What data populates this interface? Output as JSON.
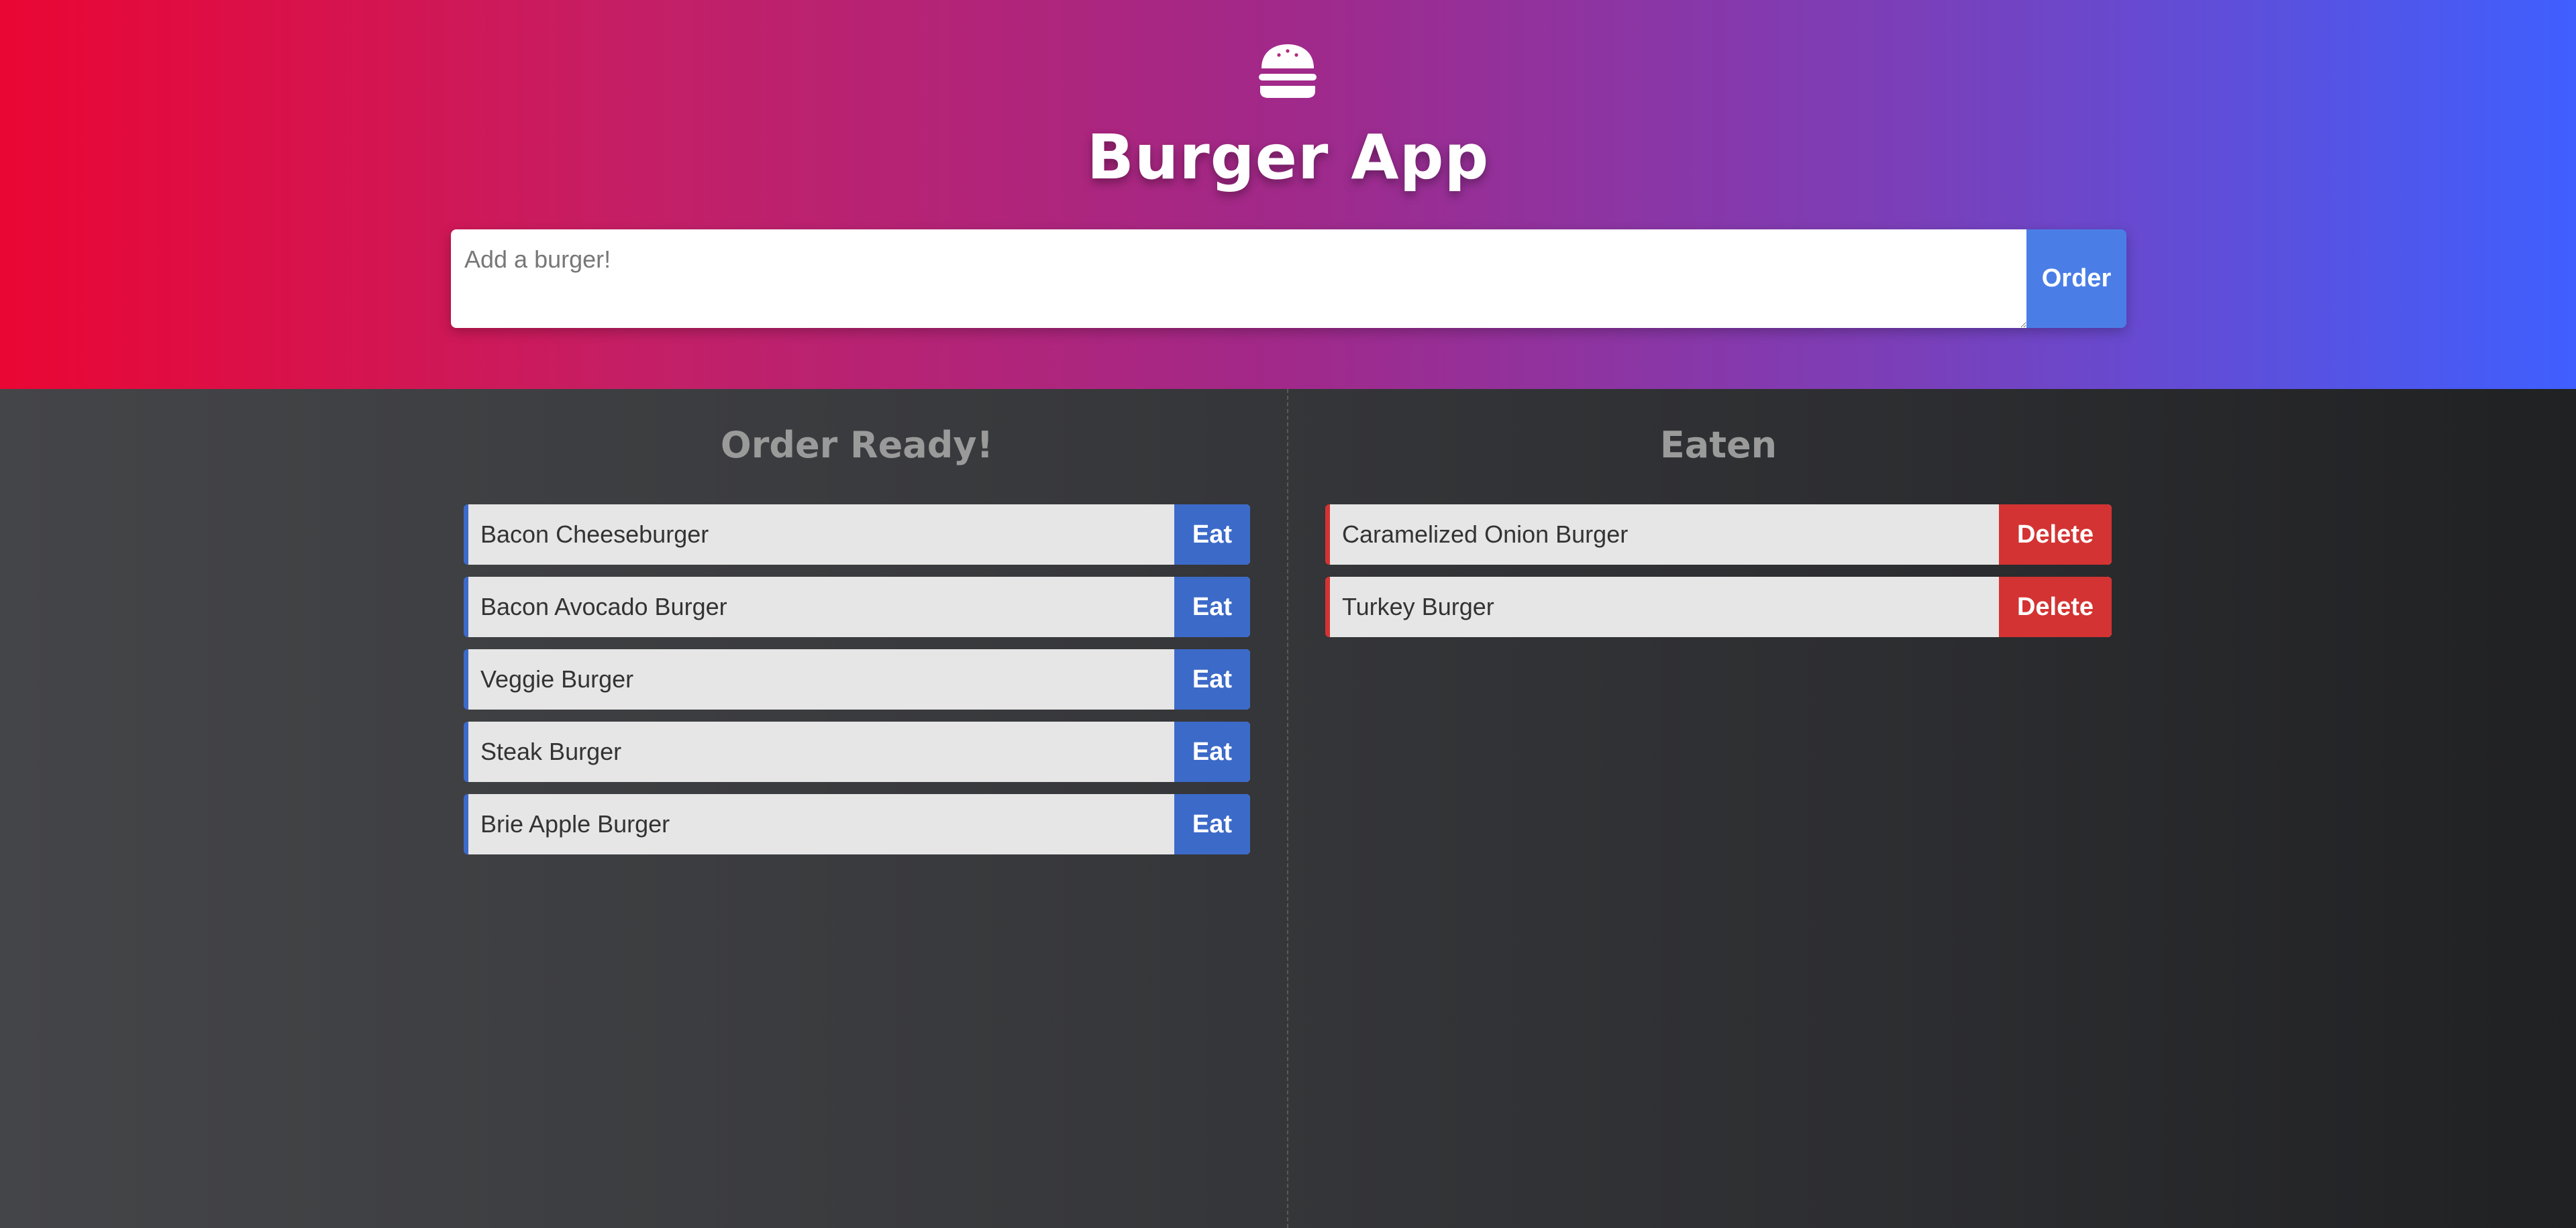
{
  "header": {
    "logo_icon": "hamburger-icon",
    "title": "Burger App",
    "input_placeholder": "Add a burger!",
    "order_button": "Order",
    "gradient_colors": [
      "#ea0634",
      "#3f5ffe"
    ]
  },
  "ready": {
    "title": "Order Ready!",
    "action_label": "Eat",
    "accent": "#3c6ac9",
    "items": [
      {
        "name": "Bacon Cheeseburger"
      },
      {
        "name": "Bacon Avocado Burger"
      },
      {
        "name": "Veggie Burger"
      },
      {
        "name": "Steak Burger"
      },
      {
        "name": "Brie Apple Burger"
      }
    ]
  },
  "eaten": {
    "title": "Eaten",
    "action_label": "Delete",
    "accent": "#d43333",
    "items": [
      {
        "name": "Caramelized Onion Burger"
      },
      {
        "name": "Turkey Burger"
      }
    ]
  }
}
